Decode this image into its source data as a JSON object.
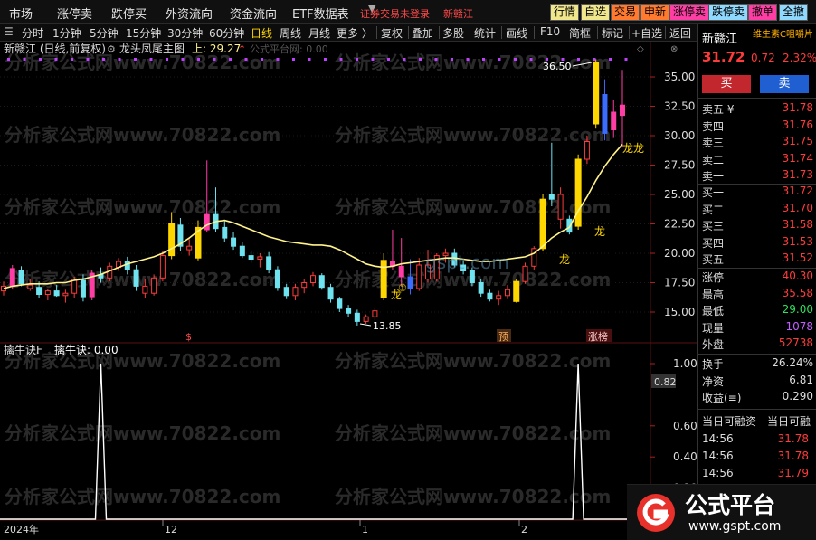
{
  "top_menu": {
    "items": [
      "市场",
      "涨停卖",
      "跌停买",
      "外资流向",
      "资金流向",
      "ETF数据表"
    ],
    "status_text": "证券交易未登录",
    "stock_tag": "新赣江",
    "quick_buttons": [
      {
        "label": "行情",
        "bg": "#f0e68c",
        "fg": "#000000"
      },
      {
        "label": "自选",
        "bg": "#f0e68c",
        "fg": "#000000"
      },
      {
        "label": "交易",
        "bg": "#ff7a2e",
        "fg": "#000000"
      },
      {
        "label": "申新",
        "bg": "#ff7a2e",
        "fg": "#000000"
      },
      {
        "label": "涨停卖",
        "bg": "#ff3ea5",
        "fg": "#000000"
      },
      {
        "label": "跌停卖",
        "bg": "#8fd9ff",
        "fg": "#000000"
      },
      {
        "label": "撤单",
        "bg": "#ff3ea5",
        "fg": "#000000"
      },
      {
        "label": "全撤",
        "bg": "#8fd9ff",
        "fg": "#000000"
      }
    ]
  },
  "timeframes": [
    "分时",
    "1分钟",
    "5分钟",
    "15分钟",
    "30分钟",
    "60分钟",
    "日线",
    "周线",
    "月线",
    "更多 〉"
  ],
  "active_timeframe": "日线",
  "toolbar": [
    "复权",
    "叠加",
    "多股",
    "统计",
    "画线",
    "F10",
    "简框",
    "标记",
    "+自选",
    "返回"
  ],
  "main_chart": {
    "stock_title": "新赣江 (日线,前复权)",
    "indicator_name": "龙头凤尾主图",
    "indicator_value_label": "上: 29.27",
    "watermark_label": "公式平台网: 0.00",
    "y_ticks": [
      "35.00",
      "32.50",
      "30.00",
      "27.50",
      "25.00",
      "22.50",
      "20.00",
      "17.50",
      "15.00"
    ],
    "high_label": "36.50",
    "low_label": "13.85",
    "dragon_labels": [
      "龙",
      "龙",
      "龙",
      "龙龙"
    ],
    "bottom_marks": [
      "$",
      "预",
      "涨榜"
    ],
    "site_watermark": "gspt.com"
  },
  "sub_chart": {
    "title": "擒牛诀F",
    "value_label": "擒牛诀: 0.00",
    "y_ticks": [
      "1.00",
      "0.82",
      "0.60",
      "0.40",
      "0.20"
    ],
    "current_tag": "0.82"
  },
  "x_axis": {
    "labels": [
      "2024年",
      "12",
      "1",
      "2"
    ]
  },
  "quote_panel": {
    "stock_name": "新赣江",
    "promo": "维生素C咀嚼片",
    "price": "31.72",
    "change": "0.72",
    "change_pct": "2.32%",
    "sell_button": "买",
    "buy_button": "卖",
    "ask": [
      {
        "label": "卖五 ¥",
        "price": "31.78"
      },
      {
        "label": "卖四",
        "price": "31.76"
      },
      {
        "label": "卖三",
        "price": "31.75"
      },
      {
        "label": "卖二",
        "price": "31.74"
      },
      {
        "label": "卖一",
        "price": "31.73"
      }
    ],
    "bid": [
      {
        "label": "买一",
        "price": "31.72"
      },
      {
        "label": "买二",
        "price": "31.70"
      },
      {
        "label": "买三",
        "price": "31.58"
      },
      {
        "label": "买四",
        "price": "31.53"
      },
      {
        "label": "买五",
        "price": "31.52"
      }
    ],
    "stats": [
      {
        "label": "涨停",
        "value": "40.30",
        "color": "#ff3b3b"
      },
      {
        "label": "最高",
        "value": "35.58",
        "color": "#ff3b3b"
      },
      {
        "label": "最低",
        "value": "29.00",
        "color": "#2ee05a"
      },
      {
        "label": "现量",
        "value": "1078",
        "color": "#c060ff"
      },
      {
        "label": "外盘",
        "value": "52738",
        "color": "#ff3b3b"
      }
    ],
    "stats2": [
      {
        "label": "换手",
        "value": "26.24%",
        "color": "#dddddd"
      },
      {
        "label": "净资",
        "value": "6.81",
        "color": "#dddddd"
      },
      {
        "label": "收益(≡)",
        "value": "0.290",
        "color": "#dddddd"
      }
    ],
    "margin_header": [
      "当日可融资",
      "当日可融"
    ],
    "ticks": [
      {
        "time": "14:56",
        "price": "31.78"
      },
      {
        "time": "14:56",
        "price": "31.78"
      },
      {
        "time": "14:56",
        "price": "31.79"
      },
      {
        "time": "14:56",
        "price": "31.79"
      }
    ]
  },
  "brand": {
    "name": "公式平台",
    "url": "www.gspt.com"
  },
  "watermark_text": "分析家公式网www.70822.com",
  "colors": {
    "up": "#ff3b3b",
    "down": "#2ee05a",
    "limit_up_bar": "#ffd700",
    "magenta_bar": "#ff3ea5",
    "cyan_bar": "#6fe3f0",
    "ma_line": "#fff38a"
  },
  "chart_data": {
    "type": "candlestick",
    "ylim": [
      13.5,
      37.0
    ],
    "candles": [
      {
        "o": 16.8,
        "h": 17.6,
        "l": 16.4,
        "c": 17.2,
        "k": "up"
      },
      {
        "o": 17.2,
        "h": 19.0,
        "l": 17.0,
        "c": 18.7,
        "k": "mag"
      },
      {
        "o": 18.5,
        "h": 18.9,
        "l": 17.2,
        "c": 17.4,
        "k": "cyan"
      },
      {
        "o": 17.3,
        "h": 17.8,
        "l": 16.8,
        "c": 17.0,
        "k": "up"
      },
      {
        "o": 17.1,
        "h": 17.6,
        "l": 16.2,
        "c": 16.5,
        "k": "cyan"
      },
      {
        "o": 16.5,
        "h": 17.0,
        "l": 16.0,
        "c": 16.8,
        "k": "up"
      },
      {
        "o": 16.8,
        "h": 17.3,
        "l": 16.3,
        "c": 16.4,
        "k": "cyan"
      },
      {
        "o": 16.4,
        "h": 16.9,
        "l": 15.8,
        "c": 16.6,
        "k": "up"
      },
      {
        "o": 16.6,
        "h": 18.0,
        "l": 16.2,
        "c": 17.8,
        "k": "up"
      },
      {
        "o": 17.7,
        "h": 18.2,
        "l": 15.9,
        "c": 16.3,
        "k": "cyan"
      },
      {
        "o": 16.3,
        "h": 18.6,
        "l": 16.0,
        "c": 18.3,
        "k": "mag"
      },
      {
        "o": 18.2,
        "h": 18.8,
        "l": 17.5,
        "c": 17.9,
        "k": "cyan"
      },
      {
        "o": 17.9,
        "h": 19.2,
        "l": 17.6,
        "c": 18.9,
        "k": "up"
      },
      {
        "o": 18.8,
        "h": 19.6,
        "l": 18.5,
        "c": 19.3,
        "k": "up"
      },
      {
        "o": 19.3,
        "h": 19.7,
        "l": 18.2,
        "c": 18.6,
        "k": "cyan"
      },
      {
        "o": 18.6,
        "h": 19.0,
        "l": 16.8,
        "c": 17.2,
        "k": "cyan"
      },
      {
        "o": 17.2,
        "h": 17.8,
        "l": 16.2,
        "c": 16.6,
        "k": "up"
      },
      {
        "o": 16.6,
        "h": 18.2,
        "l": 16.4,
        "c": 17.9,
        "k": "up"
      },
      {
        "o": 17.9,
        "h": 20.2,
        "l": 17.6,
        "c": 19.8,
        "k": "up"
      },
      {
        "o": 19.8,
        "h": 23.5,
        "l": 19.5,
        "c": 22.5,
        "k": "gold"
      },
      {
        "o": 22.4,
        "h": 23.0,
        "l": 20.2,
        "c": 20.6,
        "k": "cyan"
      },
      {
        "o": 20.6,
        "h": 21.2,
        "l": 19.8,
        "c": 20.3,
        "k": "up"
      },
      {
        "o": 19.6,
        "h": 22.8,
        "l": 19.4,
        "c": 22.2,
        "k": "gold"
      },
      {
        "o": 22.0,
        "h": 27.9,
        "l": 21.8,
        "c": 23.3,
        "k": "mag"
      },
      {
        "o": 23.3,
        "h": 25.6,
        "l": 21.8,
        "c": 22.1,
        "k": "cyan"
      },
      {
        "o": 22.2,
        "h": 22.8,
        "l": 21.0,
        "c": 21.3,
        "k": "cyan"
      },
      {
        "o": 21.3,
        "h": 21.8,
        "l": 20.3,
        "c": 20.6,
        "k": "cyan"
      },
      {
        "o": 20.6,
        "h": 21.0,
        "l": 19.6,
        "c": 19.8,
        "k": "cyan"
      },
      {
        "o": 19.8,
        "h": 20.2,
        "l": 19.2,
        "c": 19.5,
        "k": "cyan"
      },
      {
        "o": 19.5,
        "h": 20.0,
        "l": 18.8,
        "c": 19.7,
        "k": "up"
      },
      {
        "o": 19.7,
        "h": 20.1,
        "l": 18.3,
        "c": 18.6,
        "k": "cyan"
      },
      {
        "o": 18.6,
        "h": 18.9,
        "l": 16.8,
        "c": 17.1,
        "k": "cyan"
      },
      {
        "o": 17.1,
        "h": 17.4,
        "l": 16.1,
        "c": 16.4,
        "k": "cyan"
      },
      {
        "o": 16.4,
        "h": 17.4,
        "l": 16.0,
        "c": 17.1,
        "k": "up"
      },
      {
        "o": 17.1,
        "h": 17.8,
        "l": 16.6,
        "c": 17.5,
        "k": "up"
      },
      {
        "o": 17.5,
        "h": 18.4,
        "l": 17.2,
        "c": 18.1,
        "k": "up"
      },
      {
        "o": 18.1,
        "h": 18.3,
        "l": 16.9,
        "c": 17.1,
        "k": "cyan"
      },
      {
        "o": 17.1,
        "h": 17.4,
        "l": 15.8,
        "c": 16.1,
        "k": "cyan"
      },
      {
        "o": 16.1,
        "h": 16.3,
        "l": 15.0,
        "c": 15.3,
        "k": "cyan"
      },
      {
        "o": 15.3,
        "h": 15.6,
        "l": 14.6,
        "c": 14.9,
        "k": "cyan"
      },
      {
        "o": 14.9,
        "h": 15.2,
        "l": 13.85,
        "c": 14.2,
        "k": "cyan"
      },
      {
        "o": 14.2,
        "h": 14.8,
        "l": 14.0,
        "c": 14.6,
        "k": "up"
      },
      {
        "o": 14.6,
        "h": 15.4,
        "l": 14.3,
        "c": 15.1,
        "k": "up"
      },
      {
        "o": 16.2,
        "h": 20.0,
        "l": 16.0,
        "c": 19.4,
        "k": "gold"
      },
      {
        "o": 19.3,
        "h": 22.0,
        "l": 18.6,
        "c": 18.9,
        "k": "mag"
      },
      {
        "o": 18.9,
        "h": 21.3,
        "l": 17.2,
        "c": 18.0,
        "k": "mag"
      },
      {
        "o": 18.0,
        "h": 19.5,
        "l": 16.5,
        "c": 17.0,
        "k": "blue"
      },
      {
        "o": 17.0,
        "h": 19.6,
        "l": 16.8,
        "c": 19.0,
        "k": "up"
      },
      {
        "o": 19.0,
        "h": 20.3,
        "l": 17.5,
        "c": 17.8,
        "k": "up"
      },
      {
        "o": 17.8,
        "h": 20.0,
        "l": 17.6,
        "c": 19.8,
        "k": "up"
      },
      {
        "o": 19.8,
        "h": 20.4,
        "l": 19.2,
        "c": 20.0,
        "k": "up"
      },
      {
        "o": 20.0,
        "h": 20.4,
        "l": 18.8,
        "c": 19.0,
        "k": "cyan"
      },
      {
        "o": 19.0,
        "h": 19.4,
        "l": 18.2,
        "c": 18.5,
        "k": "cyan"
      },
      {
        "o": 18.5,
        "h": 18.8,
        "l": 17.2,
        "c": 17.5,
        "k": "cyan"
      },
      {
        "o": 17.5,
        "h": 17.8,
        "l": 16.3,
        "c": 16.6,
        "k": "cyan"
      },
      {
        "o": 16.6,
        "h": 16.9,
        "l": 15.9,
        "c": 16.1,
        "k": "cyan"
      },
      {
        "o": 16.1,
        "h": 16.8,
        "l": 15.6,
        "c": 16.4,
        "k": "up"
      },
      {
        "o": 16.4,
        "h": 17.3,
        "l": 16.1,
        "c": 16.9,
        "k": "up"
      },
      {
        "o": 15.9,
        "h": 17.8,
        "l": 15.8,
        "c": 17.6,
        "k": "gold"
      },
      {
        "o": 17.6,
        "h": 19.2,
        "l": 17.4,
        "c": 18.9,
        "k": "up"
      },
      {
        "o": 18.9,
        "h": 20.6,
        "l": 18.6,
        "c": 20.4,
        "k": "up"
      },
      {
        "o": 20.4,
        "h": 25.0,
        "l": 20.2,
        "c": 24.6,
        "k": "gold"
      },
      {
        "o": 24.6,
        "h": 29.4,
        "l": 24.0,
        "c": 25.0,
        "k": "cyan"
      },
      {
        "o": 25.0,
        "h": 25.6,
        "l": 22.1,
        "c": 22.9,
        "k": "up"
      },
      {
        "o": 22.9,
        "h": 23.2,
        "l": 21.6,
        "c": 21.8,
        "k": "cyan"
      },
      {
        "o": 22.3,
        "h": 28.4,
        "l": 22.0,
        "c": 28.0,
        "k": "gold"
      },
      {
        "o": 28.0,
        "h": 30.0,
        "l": 27.6,
        "c": 29.5,
        "k": "up"
      },
      {
        "o": 31.0,
        "h": 36.5,
        "l": 30.6,
        "c": 36.2,
        "k": "gold"
      },
      {
        "o": 33.5,
        "h": 34.8,
        "l": 29.6,
        "c": 30.2,
        "k": "blue"
      },
      {
        "o": 32.0,
        "h": 33.0,
        "l": 29.8,
        "c": 30.5,
        "k": "mag"
      },
      {
        "o": 32.6,
        "h": 35.6,
        "l": 29.0,
        "c": 31.72,
        "k": "mag"
      }
    ],
    "ma_line": [
      17.0,
      17.2,
      17.3,
      17.4,
      17.4,
      17.4,
      17.5,
      17.5,
      17.7,
      17.8,
      18.0,
      18.2,
      18.5,
      18.8,
      19.1,
      19.3,
      19.5,
      19.7,
      20.0,
      20.4,
      20.8,
      21.3,
      21.9,
      22.4,
      22.7,
      22.8,
      22.6,
      22.3,
      22.0,
      21.7,
      21.4,
      21.2,
      21.0,
      20.9,
      20.8,
      20.7,
      20.7,
      20.6,
      20.3,
      19.9,
      19.5,
      19.1,
      18.9,
      18.8,
      18.9,
      19.1,
      19.2,
      19.3,
      19.4,
      19.5,
      19.6,
      19.6,
      19.5,
      19.4,
      19.3,
      19.3,
      19.4,
      19.5,
      19.6,
      19.7,
      20.0,
      20.6,
      21.3,
      21.8,
      22.2,
      23.6,
      24.8,
      26.2,
      27.4,
      28.4,
      29.27
    ],
    "sub_ylim": [
      0,
      1.1
    ],
    "signal_spikes": [
      11,
      65
    ]
  }
}
